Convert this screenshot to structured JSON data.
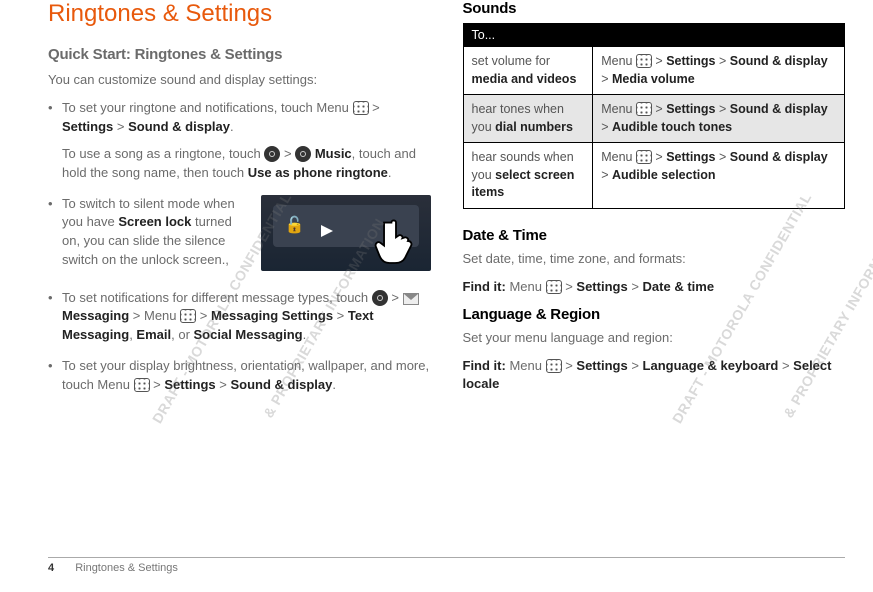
{
  "title": "Ringtones & Settings",
  "quickstart": {
    "heading": "Quick Start: Ringtones & Settings",
    "intro": "You can customize sound and display settings:",
    "b1_a": "To set your ringtone and notifications, touch Menu ",
    "b1_b": " > ",
    "b1_settings": "Settings",
    "b1_c": " > ",
    "b1_sd": "Sound & display",
    "b1_d": ".",
    "b1_p2a": "To use a song as a ringtone, touch ",
    "b1_p2b": " > ",
    "b1_music": "Music",
    "b1_p2c": ", touch and hold the song name, then touch ",
    "b1_useas": "Use as phone ringtone",
    "b1_p2d": ".",
    "b2_a": "To switch to silent mode when you have ",
    "b2_sl": "Screen lock",
    "b2_b": " turned on, you can slide the silence switch on the unlock screen.,",
    "b3_a": "To set notifications for different message types, touch ",
    "b3_b": " > ",
    "b3_msg": "Messaging",
    "b3_c": " > Menu ",
    "b3_d": " > ",
    "b3_ms": "Messaging Settings",
    "b3_e": " > ",
    "b3_tm": "Text Messaging",
    "b3_f": ", ",
    "b3_em": "Email",
    "b3_g": ", or ",
    "b3_sm": "Social Messaging",
    "b3_h": ".",
    "b4_a": "To set your display brightness, orientation, wallpaper, and more, touch Menu ",
    "b4_b": " > ",
    "b4_settings": "Settings",
    "b4_c": " > ",
    "b4_sd": "Sound & display",
    "b4_d": "."
  },
  "sounds": {
    "heading": "Sounds",
    "th": "To...",
    "rows": [
      {
        "l1": "set volume for ",
        "l2": "media and videos",
        "r1": "Menu ",
        "r2": " > ",
        "r3": "Settings",
        "r4": " > ",
        "r5": "Sound & display",
        "r6": " > ",
        "r7": "Media volume"
      },
      {
        "l1": "hear tones when you ",
        "l2": "dial numbers",
        "r1": "Menu ",
        "r2": " > ",
        "r3": "Settings",
        "r4": " > ",
        "r5": "Sound & display",
        "r6": " > ",
        "r7": "Audible touch tones"
      },
      {
        "l1": "hear sounds when you ",
        "l2": "select screen items",
        "r1": "Menu ",
        "r2": " > ",
        "r3": "Settings",
        "r4": " > ",
        "r5": "Sound & display",
        "r6": " > ",
        "r7": "Audible selection"
      }
    ]
  },
  "datetime": {
    "heading": "Date & Time",
    "body": "Set date, time, time zone, and formats:",
    "findit": "Find it:",
    "p1": " Menu ",
    "p2": " > ",
    "p3": "Settings",
    "p4": " > ",
    "p5": "Date & time"
  },
  "lang": {
    "heading": "Language & Region",
    "body": "Set your menu language and region:",
    "findit": "Find it:",
    "p1": " Menu ",
    "p2": " > ",
    "p3": "Settings",
    "p4": " > ",
    "p5": "Language & keyboard",
    "p6": " > ",
    "p7": "Select locale"
  },
  "footer": {
    "page": "4",
    "label": "Ringtones & Settings"
  },
  "watermarks": {
    "a": "DRAFT - MOTOROLA CONFIDENTIAL",
    "b": "& PROPRIETARY INFORMATION",
    "c": "DRAFT - MOTOROLA CONFIDENTIAL",
    "d": "& PROPRIETARY INFORMATION"
  }
}
